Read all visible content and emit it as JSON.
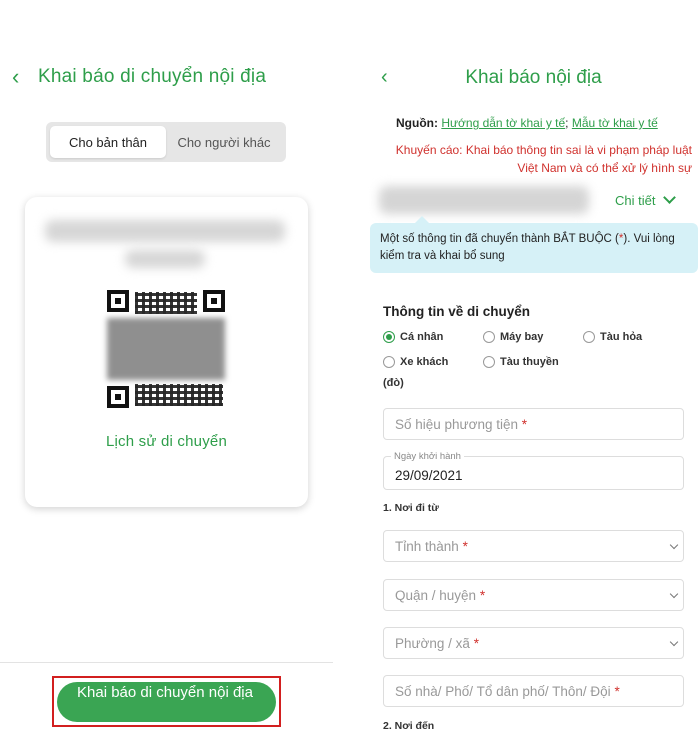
{
  "left": {
    "header": {
      "back_icon": "chevron-left-icon",
      "title": "Khai báo di chuyển nội địa"
    },
    "segmented": {
      "options": [
        "Cho bản thân",
        "Cho người khác"
      ],
      "selected": "Cho bản thân"
    },
    "card": {
      "history_link": "Lịch sử di chuyển"
    },
    "cta": {
      "label": "Khai báo di chuyển nội địa"
    }
  },
  "right": {
    "header": {
      "back_icon": "chevron-left-icon",
      "title": "Khai báo nội địa"
    },
    "source": {
      "label": "Nguồn:",
      "link1": "Hướng dẫn tờ khai y tế",
      "separator": ";",
      "link2": "Mẫu tờ khai y tế"
    },
    "warning": "Khuyến cáo: Khai báo thông tin sai là vi phạm pháp luật Việt Nam và có thể xử lý hình sự",
    "detail_label": "Chi tiết",
    "notice": {
      "before": "Một số thông tin đã chuyển thành BẮT BUỘC (",
      "star": "*",
      "after": "). Vui lòng kiểm tra và khai bổ sung"
    },
    "section_title": "Thông tin về di chuyển",
    "transport": {
      "options": [
        "Cá nhân",
        "Máy bay",
        "Tàu hỏa",
        "Xe khách",
        "Tàu thuyền"
      ],
      "selected": "Cá nhân",
      "continuation": "(đò)"
    },
    "form": {
      "vehicle_number_placeholder": "Số hiệu phương tiện",
      "required_mark": "*",
      "departure_date_label": "Ngày khởi hành",
      "departure_date_value": "29/09/2021",
      "from_heading": "1. Nơi đi từ",
      "province_placeholder": "Tỉnh thành",
      "district_placeholder": "Quận / huyện",
      "ward_placeholder": "Phường / xã",
      "address_placeholder": "Số nhà/ Phố/ Tổ dân phố/ Thôn/ Đội",
      "to_heading": "2. Nơi đến"
    }
  },
  "colors": {
    "accent": "#2e9e4a",
    "cta": "#3aa553",
    "warning": "#d0312d",
    "notice_bg": "#d6f1f7",
    "highlight_border": "#d21f1f"
  }
}
